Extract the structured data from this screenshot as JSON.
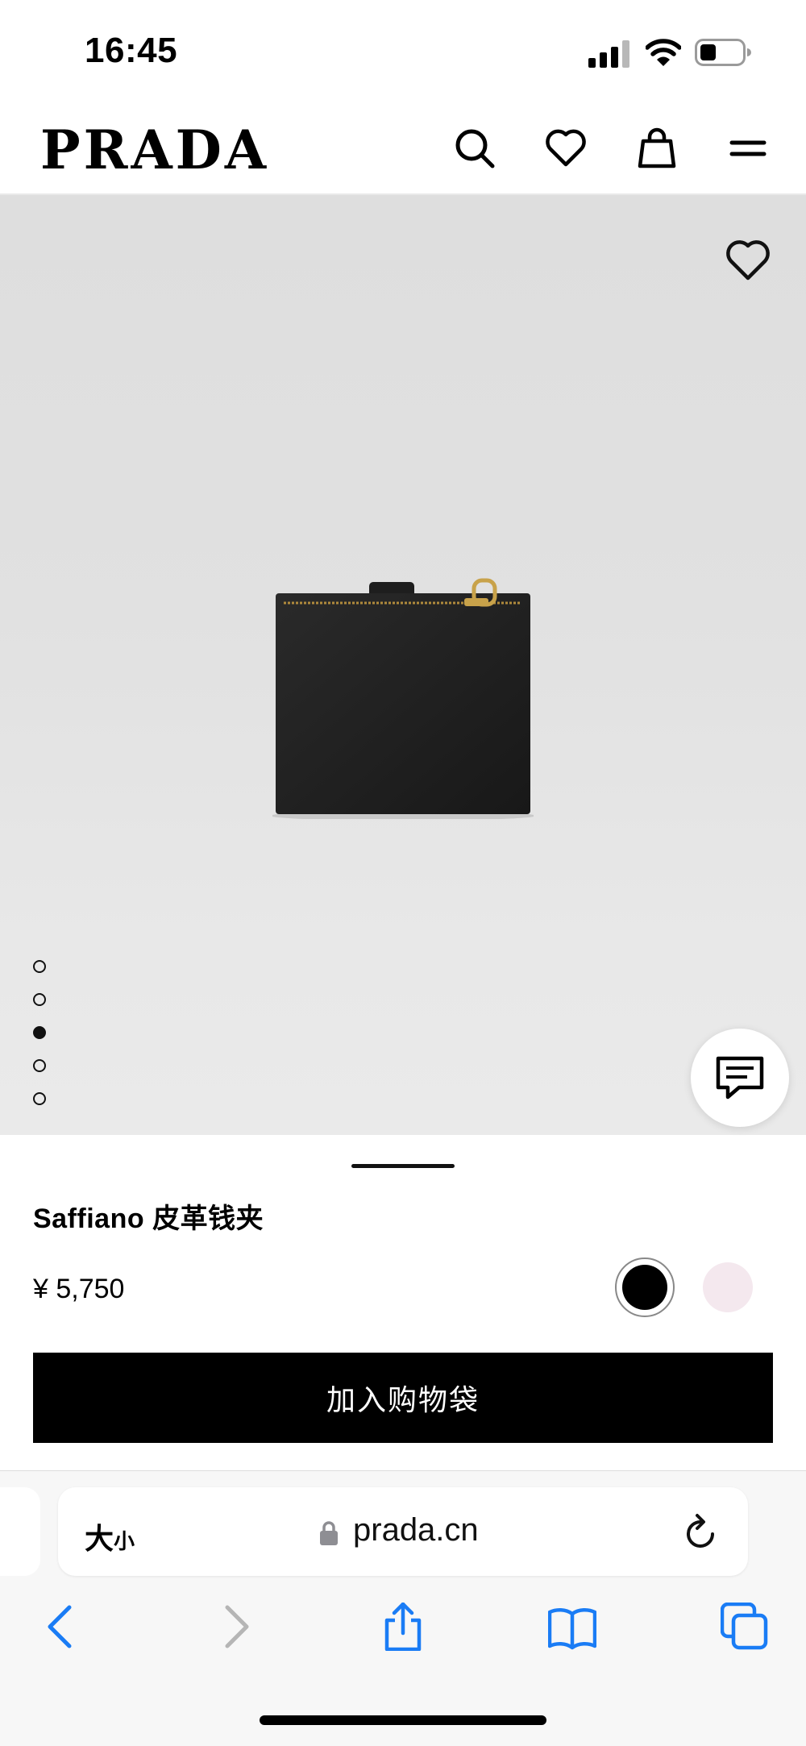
{
  "status_bar": {
    "time": "16:45"
  },
  "header": {
    "logo": "PRADA"
  },
  "gallery": {
    "image_count": 5,
    "active_index": 3
  },
  "product": {
    "name": "Saffiano 皮革钱夹",
    "price": "¥ 5,750",
    "colors": [
      {
        "name": "black",
        "hex": "#000000",
        "selected": true
      },
      {
        "name": "pink",
        "hex": "#f4e8ee",
        "selected": false
      }
    ],
    "add_to_bag_label": "加入购物袋"
  },
  "browser": {
    "text_size_label_big": "大",
    "text_size_label_small": "小",
    "url": "prada.cn"
  },
  "colors": {
    "accent_blue": "#1a7cf5",
    "gallery_bg": "#e0e0e0"
  }
}
